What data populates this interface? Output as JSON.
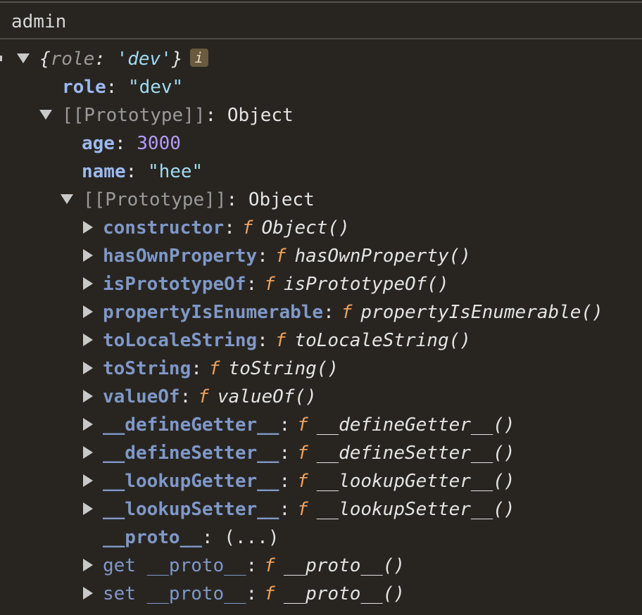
{
  "log": {
    "label": "admin"
  },
  "root": {
    "preview_open": "{",
    "preview_key": "role",
    "preview_colon": ": ",
    "preview_value": "'dev'",
    "preview_close": "}",
    "info_badge": "i",
    "own_key": "role",
    "own_value": "\"dev\""
  },
  "proto1": {
    "label": "[[Prototype]]",
    "type": "Object",
    "props": [
      {
        "key": "age",
        "value": "3000"
      },
      {
        "key": "name",
        "value": "\"hee\""
      }
    ]
  },
  "proto2": {
    "label": "[[Prototype]]",
    "type": "Object",
    "f_symbol": "f",
    "methods": [
      {
        "key": "constructor",
        "fn": "Object()"
      },
      {
        "key": "hasOwnProperty",
        "fn": "hasOwnProperty()"
      },
      {
        "key": "isPrototypeOf",
        "fn": "isPrototypeOf()"
      },
      {
        "key": "propertyIsEnumerable",
        "fn": "propertyIsEnumerable()"
      },
      {
        "key": "toLocaleString",
        "fn": "toLocaleString()"
      },
      {
        "key": "toString",
        "fn": "toString()"
      },
      {
        "key": "valueOf",
        "fn": "valueOf()"
      },
      {
        "key": "__defineGetter__",
        "fn": "__defineGetter__()"
      },
      {
        "key": "__defineSetter__",
        "fn": "__defineSetter__()"
      },
      {
        "key": "__lookupGetter__",
        "fn": "__lookupGetter__()"
      },
      {
        "key": "__lookupSetter__",
        "fn": "__lookupSetter__()"
      }
    ],
    "proto_key": "__proto__",
    "proto_value": "(...)",
    "getter": {
      "key": "get __proto__",
      "fn": "__proto__()"
    },
    "setter": {
      "key": "set __proto__",
      "fn": "__proto__()"
    }
  },
  "colors": {
    "background": "#282521",
    "key": "#9cb9f0",
    "string": "#a0dbf2",
    "number": "#b59bff",
    "function_symbol": "#f0a05a"
  }
}
